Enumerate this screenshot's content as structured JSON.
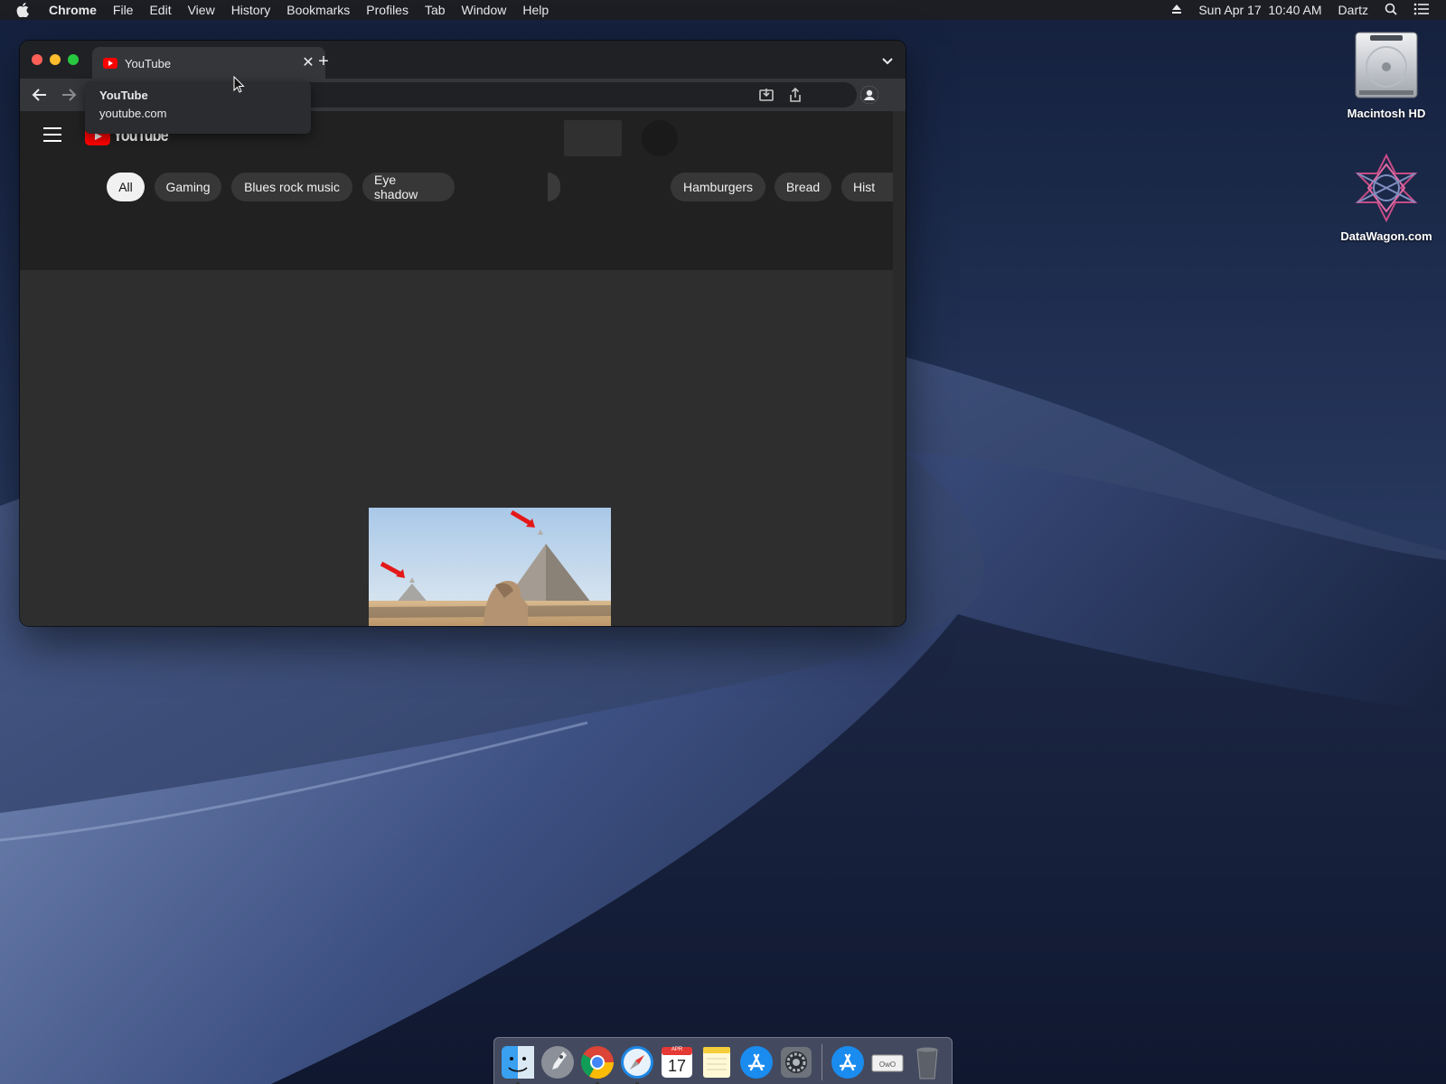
{
  "menubar": {
    "app_name": "Chrome",
    "menus": [
      "File",
      "Edit",
      "View",
      "History",
      "Bookmarks",
      "Profiles",
      "Tab",
      "Window",
      "Help"
    ],
    "datetime": "Sun Apr 17  10:40 AM",
    "user": "Dartz"
  },
  "desktop": {
    "icons": [
      {
        "label": "Macintosh HD",
        "icon": "hard-drive-icon"
      },
      {
        "label": "DataWagon.com",
        "icon": "datawagon-logo-icon"
      }
    ]
  },
  "browser": {
    "tab": {
      "title": "YouTube",
      "favicon": "youtube-favicon"
    },
    "hover_card": {
      "title": "YouTube",
      "url": "youtube.com"
    }
  },
  "youtube": {
    "logo_text": "YouTube",
    "chips": [
      {
        "label": "All",
        "active": true
      },
      {
        "label": "Gaming"
      },
      {
        "label": "Blues rock music"
      },
      {
        "label": "Eye shadow"
      },
      {
        "label": "Hamburgers"
      },
      {
        "label": "Bread"
      },
      {
        "label": "Hist"
      }
    ]
  },
  "dock": {
    "apps": [
      "finder-icon",
      "launchpad-icon",
      "chrome-icon",
      "safari-icon",
      "calendar-icon",
      "notes-icon",
      "app-store-icon",
      "system-preferences-icon",
      "app-store-downloads-icon",
      "keyboard-viewer-icon",
      "trash-icon"
    ],
    "calendar_month": "APR",
    "calendar_day": "17"
  },
  "colors": {
    "youtube_red": "#ff0000",
    "page_bg": "#212121",
    "chip_bg": "#373737",
    "chip_active_bg": "#f1f1f1"
  }
}
